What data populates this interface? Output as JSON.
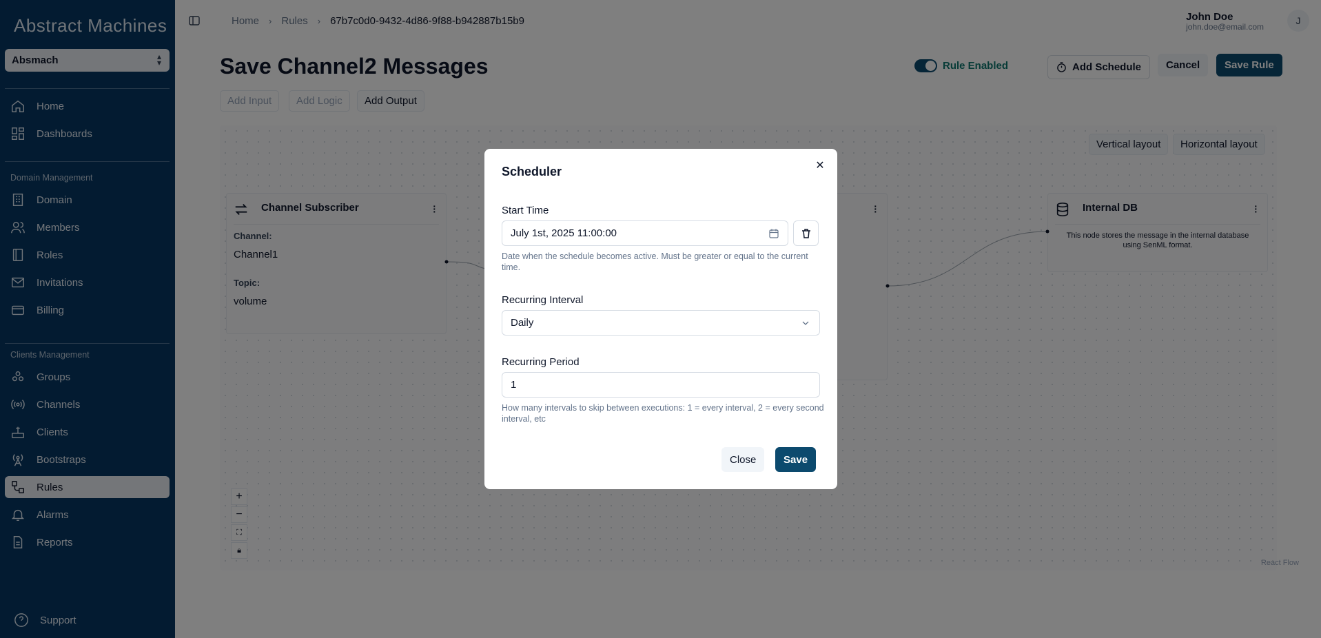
{
  "brand": "Abstract Machines",
  "org_selector": {
    "value": "Absmach"
  },
  "sidebar": {
    "items": [
      {
        "label": "Home",
        "icon": "home-icon"
      },
      {
        "label": "Dashboards",
        "icon": "dashboard-icon"
      }
    ],
    "domain_section": "Domain Management",
    "domain_items": [
      {
        "label": "Domain",
        "icon": "building-icon"
      },
      {
        "label": "Members",
        "icon": "users-icon"
      },
      {
        "label": "Roles",
        "icon": "book-icon"
      },
      {
        "label": "Invitations",
        "icon": "mail-icon"
      },
      {
        "label": "Billing",
        "icon": "credit-card-icon"
      }
    ],
    "clients_section": "Clients Management",
    "clients_items": [
      {
        "label": "Groups",
        "icon": "groups-icon"
      },
      {
        "label": "Channels",
        "icon": "radio-icon"
      },
      {
        "label": "Clients",
        "icon": "router-icon"
      },
      {
        "label": "Bootstraps",
        "icon": "antenna-icon"
      },
      {
        "label": "Rules",
        "icon": "workflow-icon"
      },
      {
        "label": "Alarms",
        "icon": "bell-icon"
      },
      {
        "label": "Reports",
        "icon": "file-icon"
      }
    ],
    "support": "Support"
  },
  "breadcrumb": {
    "home": "Home",
    "rules": "Rules",
    "current": "67b7c0d0-9432-4d86-9f88-b942887b15b9"
  },
  "user": {
    "name": "John Doe",
    "email": "john.doe@email.com",
    "initial": "J"
  },
  "page": {
    "title": "Save Channel2 Messages",
    "rule_enabled_label": "Rule Enabled",
    "add_schedule": "Add Schedule",
    "cancel": "Cancel",
    "save_rule": "Save Rule",
    "add_input": "Add Input",
    "add_logic": "Add Logic",
    "add_output": "Add Output",
    "vertical_layout": "Vertical layout",
    "horizontal_layout": "Horizontal layout",
    "react_flow": "React Flow"
  },
  "nodes": {
    "subscriber": {
      "title": "Channel Subscriber",
      "channel_label": "Channel:",
      "channel_value": "Channel1",
      "topic_label": "Topic:",
      "topic_value": "volume"
    },
    "internal_db": {
      "title": "Internal DB",
      "description": "This node stores the message in the internal database using SenML format."
    }
  },
  "modal": {
    "title": "Scheduler",
    "start_time_label": "Start Time",
    "start_time_value": "July 1st, 2025 11:00:00",
    "start_time_help": "Date when the schedule becomes active. Must be greater or equal to the current time.",
    "interval_label": "Recurring Interval",
    "interval_value": "Daily",
    "period_label": "Recurring Period",
    "period_value": "1",
    "period_help": "How many intervals to skip between executions: 1 = every interval, 2 = every second interval, etc",
    "close": "Close",
    "save": "Save"
  }
}
